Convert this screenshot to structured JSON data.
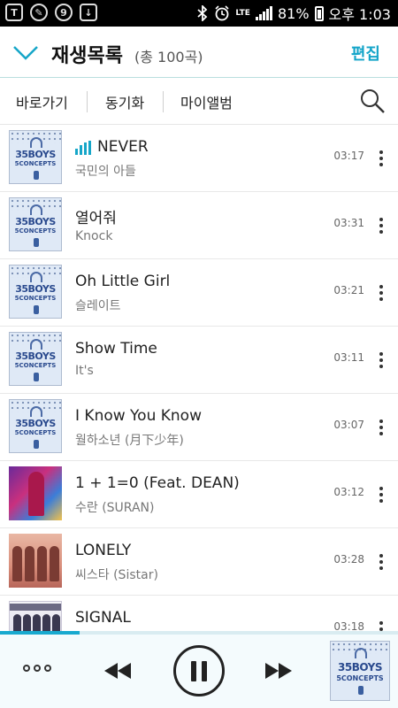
{
  "status_bar": {
    "left_icons": [
      "T",
      "✎",
      "9",
      "↓"
    ],
    "network": "LTE",
    "battery": "81%",
    "time": "오후 1:03"
  },
  "header": {
    "title": "재생목록",
    "count": "(총 100곡)",
    "edit_label": "편집"
  },
  "tabs": {
    "items": [
      "바로가기",
      "동기화",
      "마이앨범"
    ]
  },
  "songs": [
    {
      "title": "NEVER",
      "artist": "국민의 아들",
      "duration": "03:17",
      "playing": true,
      "art": "35boys"
    },
    {
      "title": "열어줘",
      "artist": "Knock",
      "duration": "03:31",
      "art": "35boys"
    },
    {
      "title": "Oh Little Girl",
      "artist": "슬레이트",
      "duration": "03:21",
      "art": "35boys"
    },
    {
      "title": "Show Time",
      "artist": "It's",
      "duration": "03:11",
      "art": "35boys"
    },
    {
      "title": "I Know You Know",
      "artist": "월하소년 (月下少年)",
      "duration": "03:07",
      "art": "35boys"
    },
    {
      "title": "1 + 1=0 (Feat. DEAN)",
      "artist": "수란 (SURAN)",
      "duration": "03:12",
      "art": "suran"
    },
    {
      "title": "LONELY",
      "artist": "씨스타 (Sistar)",
      "duration": "03:28",
      "art": "sistar"
    },
    {
      "title": "SIGNAL",
      "artist": "",
      "duration": "03:18",
      "art": "signal"
    }
  ],
  "album_art_text": {
    "line1": "35BOYS",
    "line2": "5CONCEPTS"
  },
  "player": {
    "progress_fraction": 0.2
  },
  "colors": {
    "accent": "#16a6c8",
    "status_bar": "#000000",
    "player_bg": "#f4fbfd"
  }
}
